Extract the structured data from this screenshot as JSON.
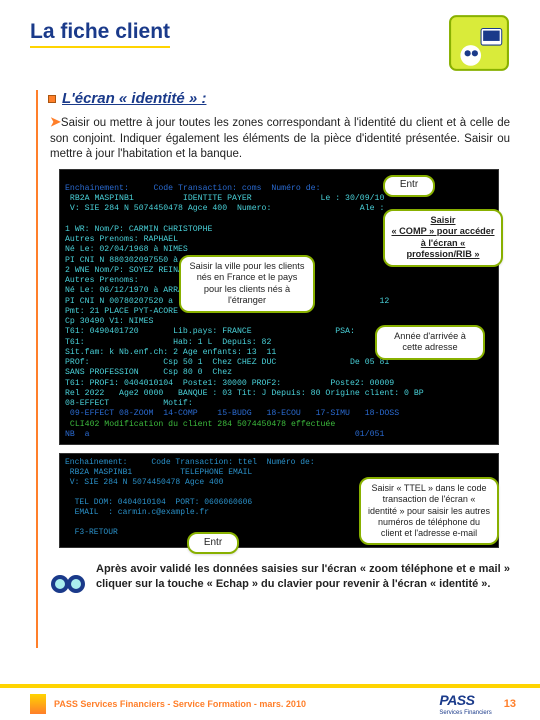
{
  "header": {
    "title": "La fiche client"
  },
  "section": {
    "heading": "L'écran « identité » :",
    "intro_arrow": "➤",
    "intro": "Saisir ou mettre à jour toutes les zones correspondant à l'identité du client et à celle de son conjoint. Indiquer également les éléments de la pièce d'identité présentée. Saisir ou mettre à jour l'habitation et la banque."
  },
  "terminal1": {
    "line1": "Enchainement:     Code Transaction: coms  Numéro de:",
    "line2": " RB2A MASPINB1          IDENTITE PAYER              Le : 30/09/10",
    "line3": " V: SIE 284 N 5074450478 Agce 400  Numero:                  Ale :",
    "line4": "",
    "line5": "1 WR: Nom/P: CARMIN CHRISTOPHE",
    "line6": "Autres Prenoms: RAPHAEL",
    "line7": "Né Le: 02/04/1968 à NIMES",
    "line8": "PI CNI N 880302097550 à PREFECTURE DE NIMES",
    "line9": "2 WNE Nom/P: SOYEZ REINA",
    "line10": "Autres Prenoms:",
    "line11": "Né Le: 06/12/1970 à ARRA",
    "line12": "PI CNI N 00780207520 a                                          12",
    "line13": "Pmt: 21 PLACE PYT-ACORE",
    "line14": "Cp 30490 V1: NIMES",
    "line15": "T61: 0490401720       Lib.pays: FRANCE                 PSA:",
    "line16": "T61:                  Hab: 1 L  Depuis: 82",
    "line17": "Sit.fam: k Nb.enf.ch: 2 Age enfants: 13  11",
    "line18": "PROf:               Csp 50 1  Chez CHEZ DUC               De 05 81",
    "line19": "SANS PROFESSION     Csp 80 0  Chez",
    "line20": "T61: PROF1: 0404010104  Poste1: 30000 PROF2:          Poste2: 00009",
    "line21": "Rel 2022   Age2 0000   BANQUE : 03 Tit: J Depuis: 80 Origine client: 0 BP",
    "line22": "08-EFFECT           Motif:",
    "line23": " 09-EFFECT 08-ZOOM  14-COMP    15-BUDG   18-ECOU   17-SIMU   18-DOSS",
    "line24": " CLI402 Modification du client 284 5074450478 effectuée",
    "line25": "NB  a                                                      01/051"
  },
  "callouts": {
    "entr": "Entr",
    "ville": "Saisir la ville pour les clients nés en France et le pays pour les clients nés à l'étranger",
    "comp_pre": "Saisir",
    "comp_mid": "« COMP » pour accéder à l'écran « profession/RIB »",
    "annee": "Année d'arrivée à cette adresse",
    "ttel": "Saisir « TTEL » dans le code transaction de l'écran « identité » pour saisir les autres numéros de téléphone du client et l'adresse e-mail"
  },
  "terminal2": {
    "lines": "Enchainement:     Code Transaction: ttel  Numéro de:\n RB2A MASPINB1          TELEPHONE EMAIL\n V: SIE 284 N 5074450478 Agce 400\n\n  TEL DOM: 0404010104  PORT: 0606060606\n  EMAIL  : carmin.c@example.fr\n\n  F3-RETOUR"
  },
  "note": "Après avoir validé les données saisies sur l'écran « zoom téléphone et e mail » cliquer sur la touche « Echap » du clavier pour revenir à l'écran « identité ».",
  "footer": {
    "left": "PASS Services Financiers - Service Formation - mars. 2010",
    "logo": "PASS",
    "logo_sub": "Services Financiers",
    "page": "13"
  }
}
